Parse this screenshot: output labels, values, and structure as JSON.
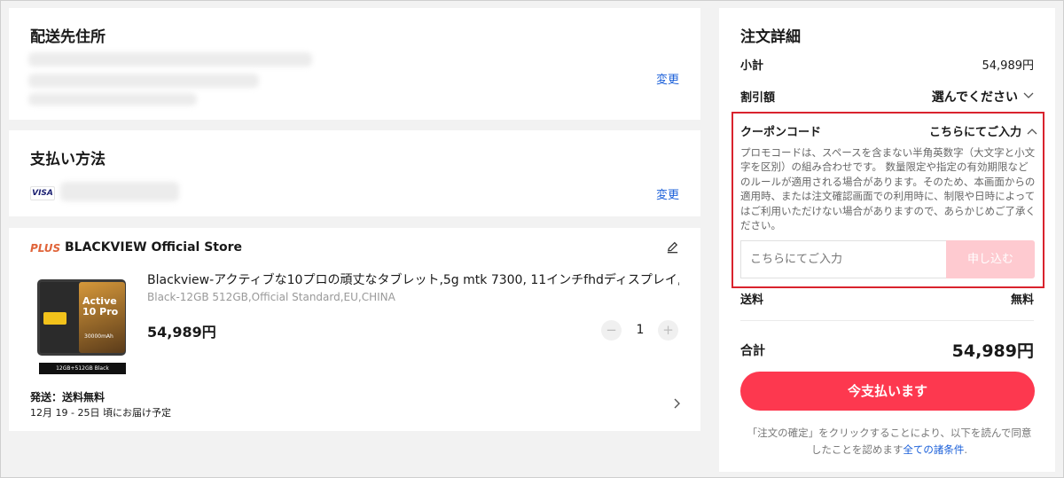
{
  "address": {
    "title": "配送先住所",
    "change": "変更"
  },
  "payment": {
    "title": "支払い方法",
    "card_brand": "VISA",
    "change": "変更"
  },
  "store": {
    "logo": "PLUS",
    "name": "BLACKVIEW Official Store",
    "product": {
      "image_text_line1": "Active",
      "image_text_line2": "10 Pro",
      "image_battery": "30000mAh",
      "image_caption": "12GB+512GB Black",
      "title": "Blackview-アクティブな10プロの頑丈なタブレット,5g mtk 7300, 11インチfhdディスプレイ,1...",
      "variant": "Black-12GB 512GB,Official Standard,EU,CHINA",
      "price": "54,989円",
      "quantity": "1",
      "minus": "−",
      "plus": "+"
    },
    "shipping": "発送：送料無料",
    "delivery": "12月 19 - 25日 頃にお届け予定"
  },
  "summary": {
    "title": "注文詳細",
    "subtotal_label": "小計",
    "subtotal_value": "54,989円",
    "discount_label": "割引額",
    "discount_value": "選んでください",
    "coupon_label": "クーポンコード",
    "coupon_action": "こちらにてご入力",
    "coupon_desc": "プロモコードは、スペースを含まない半角英数字（大文字と小文字を区別）の組み合わせです。 数量限定や指定の有効期限などのルールが適用される場合があります。そのため、本画面からの適用時、または注文確認画面での利用時に、制限や日時によってはご利用いただけない場合がありますので、あらかじめご了承ください。",
    "coupon_placeholder": "こちらにてご入力",
    "apply_button": "申し込む",
    "shipping_label": "送料",
    "shipping_value": "無料",
    "total_label": "合計",
    "total_value": "54,989円",
    "pay_button": "今支払います",
    "terms_text": "「注文の確定」をクリックすることにより、以下を読んで同意したことを認めます",
    "terms_link": "全ての諸条件",
    "terms_end": "."
  },
  "colors": {
    "accent": "#fd384f",
    "apply_disabled": "#fecad0",
    "link": "#1a5fd9",
    "highlight_border": "#d9232d"
  }
}
